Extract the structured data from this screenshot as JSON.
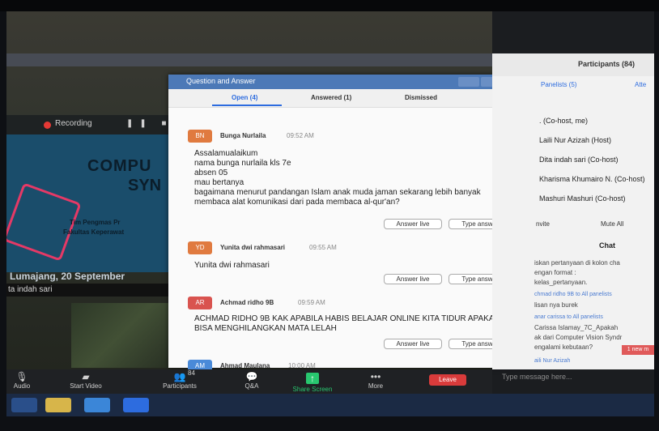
{
  "qa_window": {
    "title": "Question and Answer",
    "tabs": [
      {
        "label": "Open (4)",
        "active": true
      },
      {
        "label": "Answered (1)",
        "active": false
      },
      {
        "label": "Dismissed",
        "active": false
      }
    ],
    "questions": [
      {
        "initials": "BN",
        "color": "#e07a3f",
        "name": "Bunga Nurlaila",
        "time": "09:52 AM",
        "body": "Assalamualaikum\nnama bunga nurlaila kls 7e\nabsen 05\nmau bertanya\nbagaimana menurut pandangan Islam anak muda jaman sekarang lebih banyak membaca alat komunikasi dari pada membaca al-qur'an?",
        "answer_live": "Answer live",
        "type_answer": "Type answer"
      },
      {
        "initials": "YD",
        "color": "#e07a3f",
        "name": "Yunita dwi rahmasari",
        "time": "09:55 AM",
        "body": "Yunita dwi rahmasari",
        "answer_live": "Answer live",
        "type_answer": "Type answer"
      },
      {
        "initials": "AR",
        "color": "#d9534f",
        "name": "Achmad ridho 9B",
        "time": "09:59 AM",
        "body": "ACHMAD RIDHO 9B KAK APABILA HABIS BELAJAR ONLINE KITA TIDUR APAKAH BISA MENGHILANGKAN MATA LELAH",
        "answer_live": "Answer live",
        "type_answer": "Type answer"
      },
      {
        "initials": "AM",
        "color": "#4a8ad8",
        "name": "Ahmad Maulana",
        "time": "10:00 AM"
      }
    ]
  },
  "video": {
    "recording_label": "Recording",
    "slide_title": "COMPU",
    "slide_sub": "SYN",
    "slide_line1": "Tim Pengmas Pr",
    "slide_line2": "Fakultas Keperawat",
    "date_text": "Lumajang, 20 September",
    "name_label": "ta indah sari"
  },
  "participants": {
    "title": "Participants (84)",
    "panelists_tab": "Panelists (5)",
    "attendees_tab": "Atte",
    "rows": [
      ". (Co-host, me)",
      "Laili Nur Azizah (Host)",
      "Dita indah sari (Co-host)",
      "Kharisma Khumairo N. (Co-host)",
      "Mashuri Mashuri (Co-host)"
    ],
    "invite": "nvite",
    "mute_all": "Mute All"
  },
  "chat": {
    "title": "Chat",
    "lines": [
      {
        "text": "iskan pertanyaan di kolon cha",
        "meta": false
      },
      {
        "text": "engan format :",
        "meta": false
      },
      {
        "text": "kelas_pertanyaan.",
        "meta": false
      },
      {
        "text": "chmad ridho 9B to All panelists",
        "meta": true
      },
      {
        "text": "lisan nya burek",
        "meta": false
      },
      {
        "text": "anar carissa to All panelists",
        "meta": true
      },
      {
        "text": "Carissa Islamay_7C_Apakah",
        "meta": false
      },
      {
        "text": "ak dari Computer Vision Syndr",
        "meta": false
      },
      {
        "text": "engalami kebutaan?",
        "meta": false
      },
      {
        "text": "aili Nur Azizah",
        "meta": true
      }
    ],
    "new_badge": "1 new m",
    "type_message": "Type message here..."
  },
  "toolbar": {
    "audio": "Audio",
    "start_video": "Start Video",
    "participants": "Participants",
    "participants_count": "84",
    "qa": "Q&A",
    "share_screen": "Share Screen",
    "more": "More",
    "leave": "Leave"
  }
}
